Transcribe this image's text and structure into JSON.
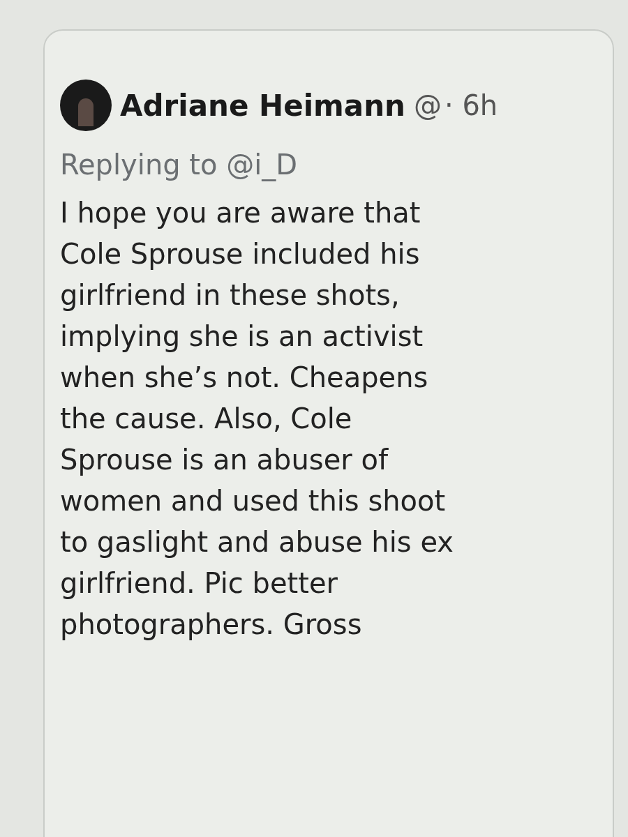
{
  "tweet": {
    "author": "Adriane Heimann",
    "handle": "@",
    "time": "· 6h",
    "replying_to": "Replying to @i_D",
    "body_lines": [
      "I hope you are aware that",
      "Cole Sprouse included his",
      "girlfriend in these shots,",
      "implying she is an activist",
      "when she’s not. Cheapens",
      "the cause. Also, Cole",
      "Sprouse is an abuser of",
      "women and used this shoot",
      "to gaslight and abuse his ex",
      "girlfriend. Pic better",
      "photographers. Gross"
    ]
  }
}
